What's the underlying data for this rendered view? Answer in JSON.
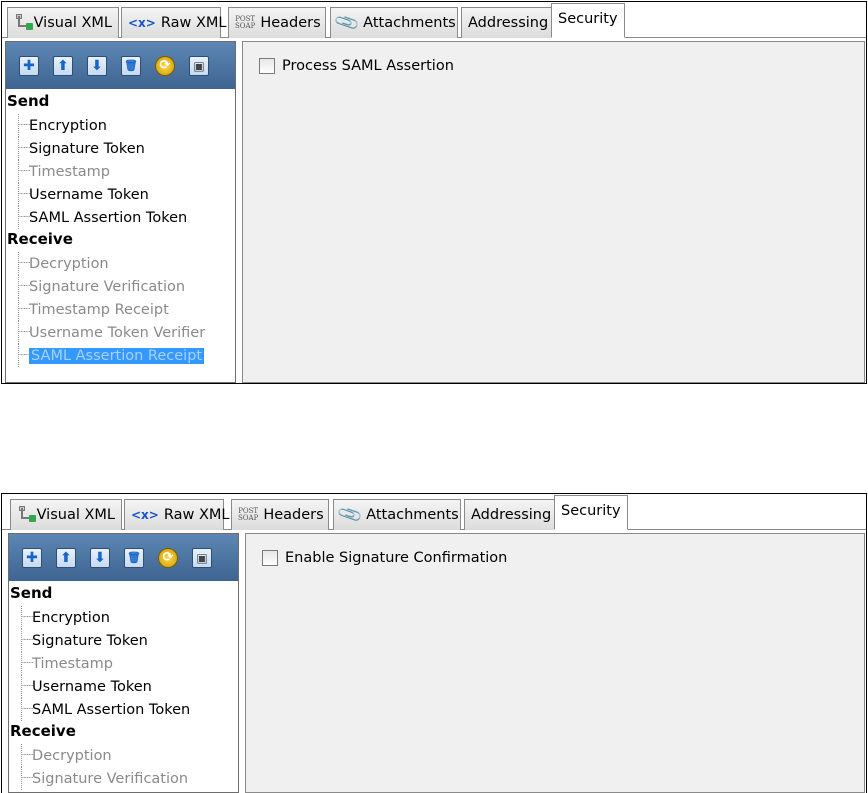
{
  "tabs": [
    {
      "label": "Visual XML",
      "icon": "tree-icon"
    },
    {
      "label": "Raw XML",
      "icon": "xml-tag-icon",
      "icon_text": "<x>"
    },
    {
      "label": "Headers",
      "icon": "post-soap-icon",
      "icon_text_top": "POST",
      "icon_text_bottom": "SOAP"
    },
    {
      "label": "Attachments",
      "icon": "paperclip-icon"
    },
    {
      "label": "Addressing"
    },
    {
      "label": "Security",
      "active": true
    }
  ],
  "toolbar": {
    "buttons": [
      {
        "name": "add-icon",
        "glyph": "✚"
      },
      {
        "name": "move-up-icon",
        "glyph": "⬆"
      },
      {
        "name": "move-down-icon",
        "glyph": "⬇"
      },
      {
        "name": "delete-icon",
        "glyph": "🗑"
      },
      {
        "name": "refresh-icon",
        "glyph": "⟳"
      },
      {
        "name": "save-icon",
        "glyph": "▣"
      }
    ]
  },
  "tree": {
    "send_label": "Send",
    "receive_label": "Receive",
    "send_items": [
      {
        "label": "Encryption",
        "enabled": true
      },
      {
        "label": "Signature Token",
        "enabled": true
      },
      {
        "label": "Timestamp",
        "enabled": false
      },
      {
        "label": "Username Token",
        "enabled": true
      },
      {
        "label": "SAML Assertion Token",
        "enabled": true
      }
    ],
    "receive_items_screen1": [
      {
        "label": "Decryption",
        "enabled": false
      },
      {
        "label": "Signature Verification",
        "enabled": false
      },
      {
        "label": "Timestamp Receipt",
        "enabled": false
      },
      {
        "label": "Username Token Verifier",
        "enabled": false
      },
      {
        "label": "SAML Assertion Receipt",
        "enabled": false,
        "selected": true
      }
    ],
    "receive_items_screen2": [
      {
        "label": "Decryption",
        "enabled": false
      },
      {
        "label": "Signature Verification",
        "enabled": false
      }
    ]
  },
  "screen1": {
    "checkbox_label": "Process SAML Assertion",
    "checked": false
  },
  "screen2": {
    "checkbox_label": "Enable Signature Confirmation",
    "checked": false
  },
  "colors": {
    "toolbar": "#4a72a0",
    "selection": "#3399ff",
    "panel_bg": "#f0f0f0",
    "disabled_text": "#8a8a8a"
  }
}
